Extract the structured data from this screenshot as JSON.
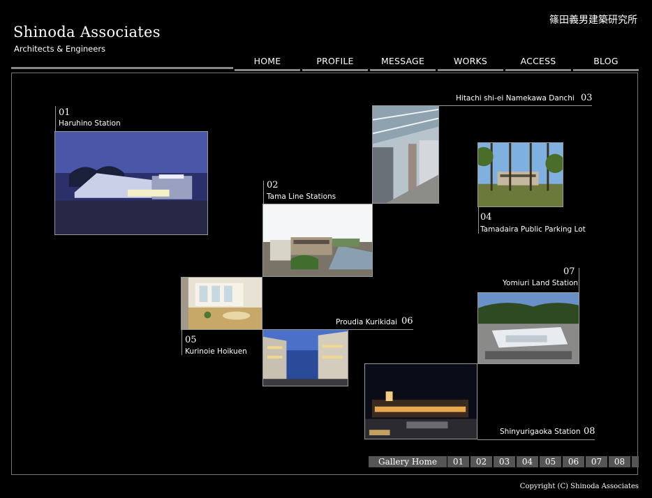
{
  "brand": {
    "title": "Shinoda Associates",
    "subtitle": "Architects & Engineers",
    "japanese_name": "篠田義男建築研究所"
  },
  "nav": [
    {
      "label": "HOME"
    },
    {
      "label": "PROFILE"
    },
    {
      "label": "MESSAGE"
    },
    {
      "label": "WORKS"
    },
    {
      "label": "ACCESS"
    },
    {
      "label": "BLOG"
    }
  ],
  "works": [
    {
      "number": "01",
      "caption": "Haruhino Station"
    },
    {
      "number": "02",
      "caption": "Tama Line Stations"
    },
    {
      "number": "03",
      "caption": "Hitachi shi-ei Namekawa Danchi"
    },
    {
      "number": "04",
      "caption": "Tamadaira Public Parking Lot"
    },
    {
      "number": "05",
      "caption": "Kurinoie Hoikuen"
    },
    {
      "number": "06",
      "caption": "Proudia Kurikidai"
    },
    {
      "number": "07",
      "caption": "Yomiuri Land Station"
    },
    {
      "number": "08",
      "caption": "Shinyurigaoka Station"
    }
  ],
  "gallery_nav": {
    "home_label": "Gallery Home",
    "numbers": [
      "01",
      "02",
      "03",
      "04",
      "05",
      "06",
      "07",
      "08"
    ]
  },
  "copyright": "Copyright (C) Shinoda Associates",
  "colors": {
    "background": "#000000",
    "rule": "#888888",
    "gallery_bar": "#555555"
  }
}
